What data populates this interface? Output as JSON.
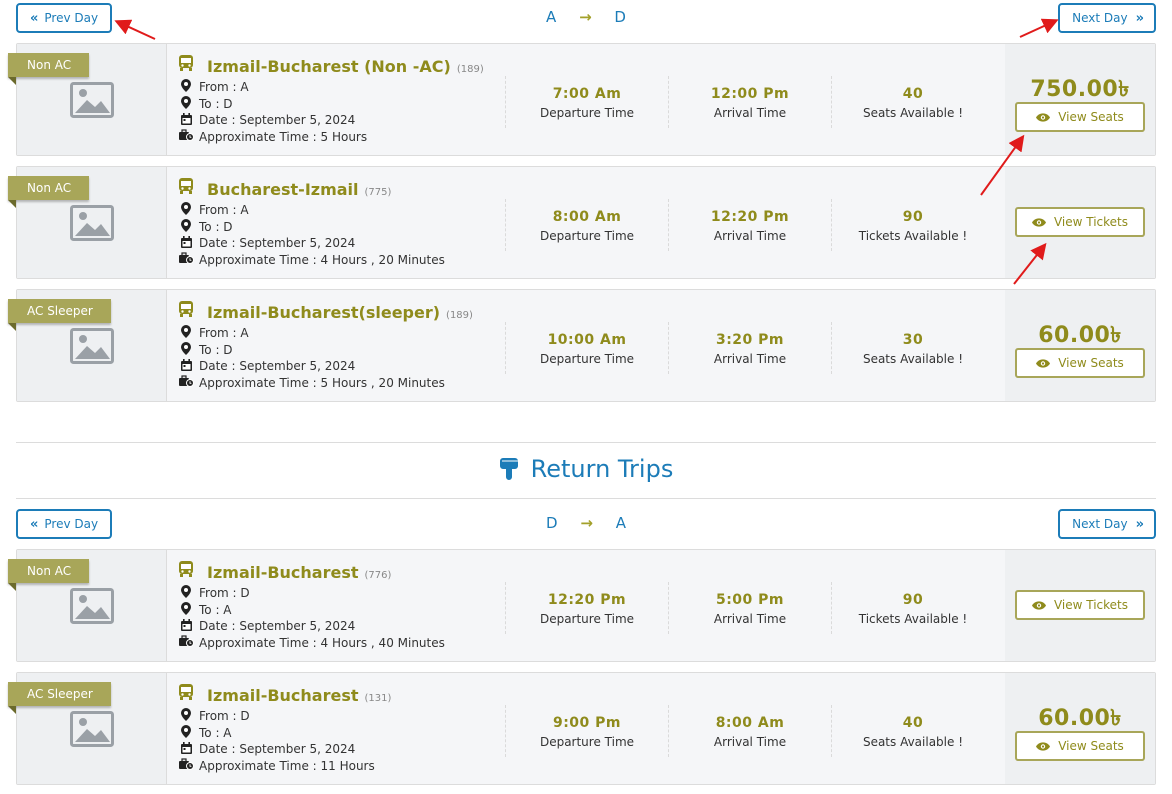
{
  "outbound": {
    "prev_label": "Prev Day",
    "next_label": "Next Day",
    "from": "A",
    "to": "D",
    "trips": [
      {
        "badge": "Non AC",
        "name": "Izmail-Bucharest (Non -AC)",
        "code": "(189)",
        "from": "From : A",
        "to": "To : D",
        "date": "Date : September 5, 2024",
        "duration": "Approximate Time : 5 Hours",
        "departure": "7:00 Am",
        "departure_label": "Departure Time",
        "arrival": "12:00 Pm",
        "arrival_label": "Arrival Time",
        "seats": "40",
        "seats_label": "Seats Available !",
        "price": "750.00৳",
        "button": "View Seats"
      },
      {
        "badge": "Non AC",
        "name": "Bucharest-Izmail",
        "code": "(775)",
        "from": "From : A",
        "to": "To : D",
        "date": "Date : September 5, 2024",
        "duration": "Approximate Time : 4 Hours , 20 Minutes",
        "departure": "8:00 Am",
        "departure_label": "Departure Time",
        "arrival": "12:20 Pm",
        "arrival_label": "Arrival Time",
        "seats": "90",
        "seats_label": "Tickets Available !",
        "price": "",
        "button": "View Tickets"
      },
      {
        "badge": "AC Sleeper",
        "name": "Izmail-Bucharest(sleeper)",
        "code": "(189)",
        "from": "From : A",
        "to": "To : D",
        "date": "Date : September 5, 2024",
        "duration": "Approximate Time : 5 Hours , 20 Minutes",
        "departure": "10:00 Am",
        "departure_label": "Departure Time",
        "arrival": "3:20 Pm",
        "arrival_label": "Arrival Time",
        "seats": "30",
        "seats_label": "Seats Available !",
        "price": "60.00৳",
        "button": "View Seats"
      }
    ]
  },
  "return_title": "Return Trips",
  "return": {
    "prev_label": "Prev Day",
    "next_label": "Next Day",
    "from": "D",
    "to": "A",
    "trips": [
      {
        "badge": "Non AC",
        "name": "Izmail-Bucharest",
        "code": "(776)",
        "from": "From : D",
        "to": "To : A",
        "date": "Date : September 5, 2024",
        "duration": "Approximate Time : 4 Hours , 40 Minutes",
        "departure": "12:20 Pm",
        "departure_label": "Departure Time",
        "arrival": "5:00 Pm",
        "arrival_label": "Arrival Time",
        "seats": "90",
        "seats_label": "Tickets Available !",
        "price": "",
        "button": "View Tickets"
      },
      {
        "badge": "AC Sleeper",
        "name": "Izmail-Bucharest",
        "code": "(131)",
        "from": "From : D",
        "to": "To : A",
        "date": "Date : September 5, 2024",
        "duration": "Approximate Time : 11 Hours",
        "departure": "9:00 Pm",
        "departure_label": "Departure Time",
        "arrival": "8:00 Am",
        "arrival_label": "Arrival Time",
        "seats": "40",
        "seats_label": "Seats Available !",
        "price": "60.00৳",
        "button": "View Seats"
      }
    ]
  },
  "colors": {
    "accent_blue": "#1c7cb8",
    "accent_olive": "#8f8b1c",
    "badge": "#a8a659",
    "annotation_arrow": "#e01b1b"
  },
  "icons": [
    "double-chevron-left-icon",
    "double-chevron-right-icon",
    "arrow-right-icon",
    "bus-icon",
    "map-pin-icon",
    "calendar-icon",
    "luggage-clock-icon",
    "image-placeholder-icon",
    "eye-icon",
    "pointing-hand-icon"
  ]
}
